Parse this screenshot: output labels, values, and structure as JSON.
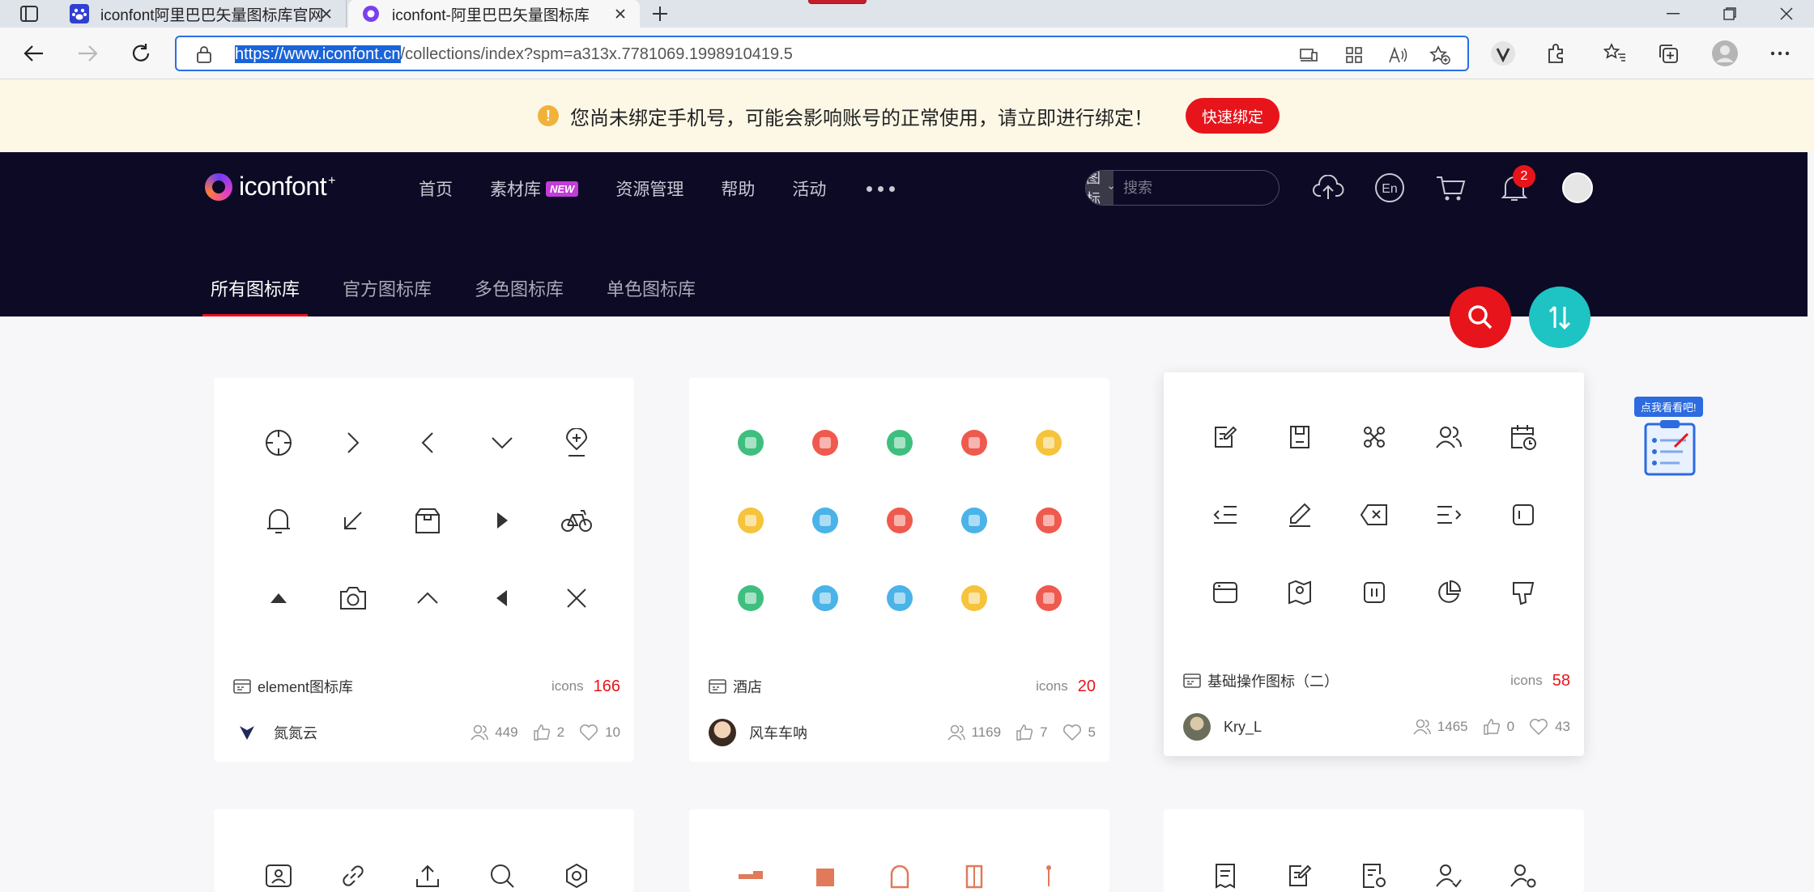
{
  "browser": {
    "tabs": [
      {
        "title": "iconfont阿里巴巴矢量图标库官网"
      },
      {
        "title": "iconfont-阿里巴巴矢量图标库"
      }
    ],
    "url_selected": "https://www.iconfont.cn",
    "url_rest": "/collections/index?spm=a313x.7781069.1998910419.5"
  },
  "notice": {
    "text": "您尚未绑定手机号，可能会影响账号的正常使用，请立即进行绑定！",
    "button": "快速绑定"
  },
  "header": {
    "logo": "iconfont",
    "logo_sup": "+",
    "nav": [
      {
        "label": "首页"
      },
      {
        "label": "素材库",
        "badge": "NEW"
      },
      {
        "label": "资源管理"
      },
      {
        "label": "帮助"
      },
      {
        "label": "活动"
      }
    ],
    "search_type": "图标",
    "search_placeholder": "搜索",
    "notif_count": "2",
    "lang_label": "En"
  },
  "subnav": [
    {
      "label": "所有图标库",
      "active": true
    },
    {
      "label": "官方图标库"
    },
    {
      "label": "多色图标库"
    },
    {
      "label": "单色图标库"
    }
  ],
  "cards": [
    {
      "name": "element图标库",
      "icons_label": "icons",
      "count": "166",
      "author": "氮氮云",
      "stat_users": "449",
      "stat_likes": "2",
      "stat_favs": "10"
    },
    {
      "name": "酒店",
      "icons_label": "icons",
      "count": "20",
      "author": "风车车呐",
      "stat_users": "1169",
      "stat_likes": "7",
      "stat_favs": "5"
    },
    {
      "name": "基础操作图标（二）",
      "icons_label": "icons",
      "count": "58",
      "author": "Kry_L",
      "stat_users": "1465",
      "stat_likes": "0",
      "stat_favs": "43"
    }
  ],
  "side_widget": {
    "tag": "点我看看吧!"
  },
  "colors": {
    "brand_red": "#e8141b",
    "teal": "#1ec3c4",
    "header_bg": "#0c0a24",
    "notice_bg": "#fdf8e6"
  }
}
